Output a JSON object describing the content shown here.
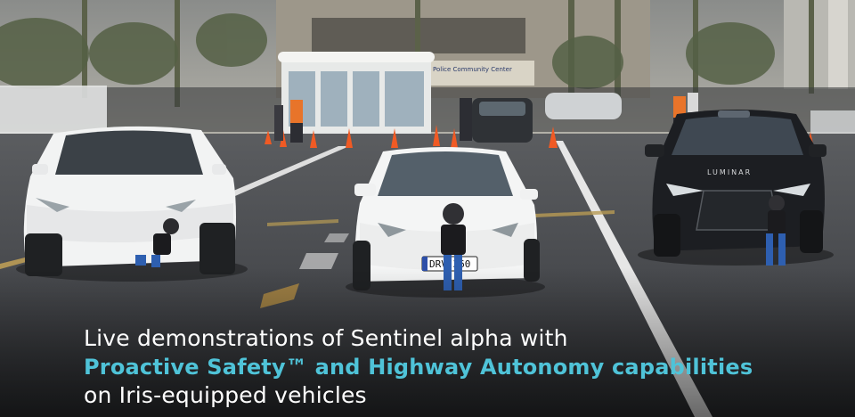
{
  "caption": {
    "line1": "Live demonstrations of Sentinel alpha with",
    "line2": "Proactive Safety™ and Highway Autonomy capabilities",
    "line3": "on Iris-equipped vehicles"
  },
  "scene": {
    "building_sign": "Police Community Center",
    "front_car_plate": "DRV 360",
    "suv_hood_brand": "LUMINAR"
  },
  "colors": {
    "accent": "#4fc3d8",
    "text": "#ffffff",
    "asphalt": "#3d3f43",
    "cone": "#f05a24"
  }
}
